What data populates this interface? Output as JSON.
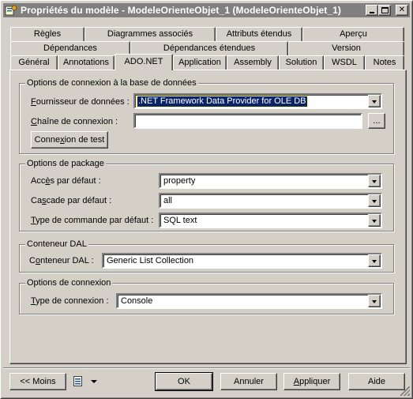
{
  "window": {
    "title": "Propriétés du modèle - ModeleOrienteObjet_1 (ModeleOrienteObjet_1)"
  },
  "tabs": {
    "row1": [
      "Règles",
      "Diagrammes associés",
      "Attributs étendus",
      "Aperçu"
    ],
    "row2": [
      "Dépendances",
      "Dépendances étendues",
      "Version"
    ],
    "row3": [
      "Général",
      "Annotations",
      "ADO.NET",
      "Application",
      "Assembly",
      "Solution",
      "WSDL",
      "Notes"
    ],
    "active": "ADO.NET"
  },
  "connection_group": {
    "title": "Options de connexion à la base de données",
    "provider_label": "Fournisseur de données :",
    "provider_label_accel": "F",
    "provider_label_rest": "ournisseur de données :",
    "provider_value": ".NET Framework Data Provider for OLE DB",
    "connstring_label_accel": "C",
    "connstring_label_rest": "haîne de connexion :",
    "connstring_value": "",
    "browse_label": "...",
    "test_label_accel": "x",
    "test_label_pre": "Conne",
    "test_label_rest": "ion de test"
  },
  "package_group": {
    "title": "Options de package",
    "access_label_pre": "Acc",
    "access_label_accel": "è",
    "access_label_rest": "s par défaut :",
    "access_value": "property",
    "cascade_label_pre": "Ca",
    "cascade_label_accel": "s",
    "cascade_label_rest": "cade par défaut :",
    "cascade_value": "all",
    "command_label_accel": "T",
    "command_label_rest": "ype de commande par défaut :",
    "command_value": "SQL text"
  },
  "dal_group": {
    "title": "Conteneur DAL",
    "dal_label_pre": "C",
    "dal_label_accel": "o",
    "dal_label_rest": "nteneur DAL :",
    "dal_value": "Generic List Collection"
  },
  "conn_options_group": {
    "title": "Options de connexion",
    "type_label_accel": "T",
    "type_label_rest": "ype de connexion :",
    "type_value": "Console"
  },
  "footer": {
    "less_label": "<< Moins",
    "ok_label": "OK",
    "cancel_label": "Annuler",
    "apply_label_pre": "",
    "apply_label_accel": "A",
    "apply_label_rest": "ppliquer",
    "help_label": "Aide"
  }
}
